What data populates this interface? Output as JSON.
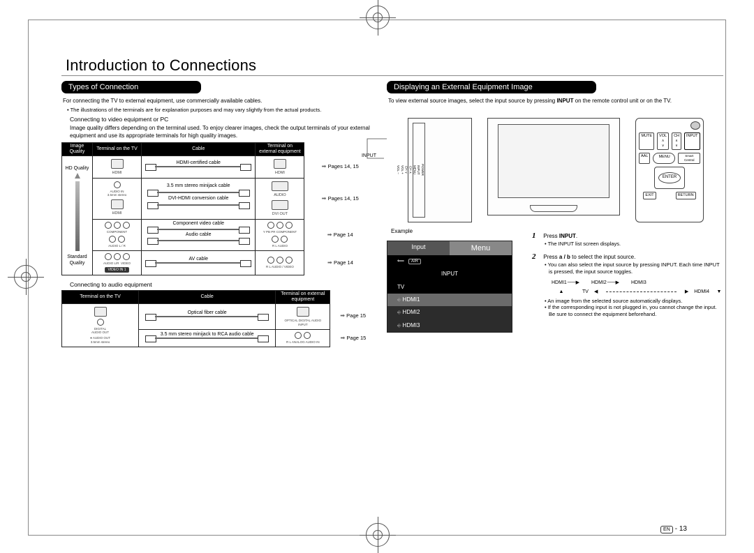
{
  "page": {
    "title": "Introduction to Connections",
    "lang_badge": "EN",
    "number": "13"
  },
  "left": {
    "band": "Types of Connection",
    "intro": "For connecting the TV to external equipment, use commercially available cables.",
    "note": "The illustrations of the terminals are for explanation purposes and may vary slightly from the actual products.",
    "sub_video": "Connecting to video equipment or PC",
    "video_para": "Image quality differs depending on the terminal used. To enjoy clearer images, check the output terminals of your external equipment and use its appropriate terminals for high quality images.",
    "video_table": {
      "headers": [
        "Image Quality",
        "Terminal on the TV",
        "Cable",
        "Terminal on external equipment",
        ""
      ],
      "quality_top": "HD Quality",
      "quality_bottom": "Standard Quality",
      "rows": [
        {
          "tv_term": "HDMI",
          "cable": "HDMI-certiﬁed cable",
          "ext_term": "HDMI",
          "ref": "Pages 14, 15"
        },
        {
          "tv_term": "AUDIO IN / HDMI",
          "cable_a": "3.5 mm stereo minijack cable",
          "cable_b": "DVI-HDMI conversion cable",
          "ext_a": "AUDIO",
          "ext_b": "DVI OUT",
          "ref": "Pages 14, 15"
        },
        {
          "tv_term": "COMPONENT / AUDIO",
          "cable_a": "Component video cable",
          "cable_b": "Audio cable",
          "ext_a": "Y PB PR COMPONENT",
          "ext_b": "R L AUDIO",
          "ref": "Page 14"
        },
        {
          "tv_term": "AUDIO / VIDEO",
          "cable": "AV cable",
          "ext_term": "R L AUDIO / VIDEO",
          "ref": "Page 14"
        }
      ]
    },
    "sub_audio": "Connecting to audio equipment",
    "audio_table": {
      "headers": [
        "Terminal on the TV",
        "Cable",
        "Terminal on external equipment",
        ""
      ],
      "rows": [
        {
          "tv_term": "DIGITAL AUDIO OUT",
          "cable": "Optical ﬁber cable",
          "ext_term": "OPTICAL DIGITAL AUDIO INPUT",
          "ref": "Page 15"
        },
        {
          "tv_term": "AUDIO OUT 3.5mm stereo",
          "cable": "3.5 mm stereo minijack to RCA audio cable",
          "ext_term": "R L ANALOG AUDIO IN",
          "ref": "Page 15"
        }
      ]
    }
  },
  "right": {
    "band": "Displaying an External Equipment Image",
    "intro_a": "To view external source images, select the input source by pressing ",
    "intro_bold": "INPUT",
    "intro_b": " on the remote control unit or on the TV.",
    "input_label": "INPUT",
    "example_label": "Example",
    "example_box": {
      "tab_left": "Input",
      "tab_right": "Menu",
      "air_tag": "AIR",
      "header": "INPUT",
      "items": [
        "TV",
        "HDMI1",
        "HDMI2",
        "HDMI3"
      ],
      "selected_index": 1
    },
    "remote": {
      "row0": [
        "POWER"
      ],
      "row1": [
        "MUTE",
        "VOL",
        "CH",
        "INPUT"
      ],
      "row2": [
        "AAL",
        "MENU",
        "Smart Central"
      ],
      "enter": "ENTER",
      "row3": [
        "EXIT",
        "RETURN"
      ]
    },
    "steps": [
      {
        "n": "1",
        "text_a": "Press ",
        "bold": "INPUT",
        "text_b": ".",
        "subs": [
          "The INPUT list screen displays."
        ]
      },
      {
        "n": "2",
        "text_a": "Press ",
        "glyph": "a / b",
        "text_b": " to select the input source.",
        "subs": [
          "You can also select the input source by pressing INPUT. Each time INPUT is pressed, the input source toggles.",
          "",
          "An image from the selected source automatically displays.",
          "If the corresponding input is not plugged in, you cannot change the input. Be sure to connect the equipment beforehand."
        ]
      }
    ],
    "cycle": [
      "HDMI1",
      "HDMI2",
      "HDMI3",
      "TV",
      "HDMI4"
    ]
  }
}
